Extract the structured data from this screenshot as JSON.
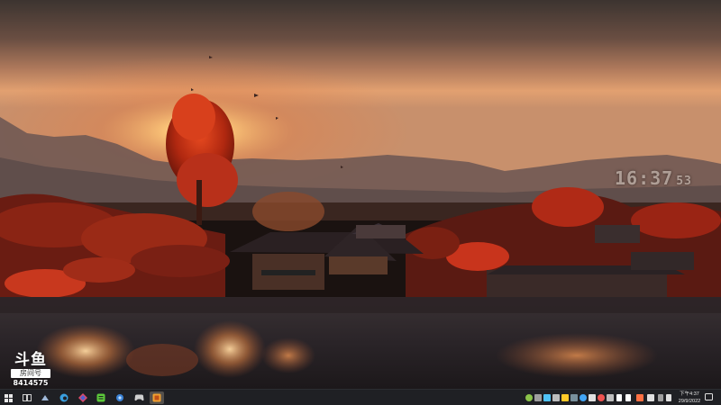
{
  "wallpaper": {
    "description_icon": "landscape-wallpaper"
  },
  "clock_widget": {
    "time": "16:37",
    "seconds": "53"
  },
  "watermark": {
    "logo": "斗鱼",
    "room_label": "房间号",
    "room_number": "8414575"
  },
  "taskbar": {
    "start_icon": "windows-start-icon",
    "pinned": [
      {
        "name": "task-view-icon",
        "color": "#cfcfcf"
      },
      {
        "name": "steam-icon",
        "color": "#9fb8d8"
      },
      {
        "name": "edge-icon",
        "color": "#3aa0e0"
      },
      {
        "name": "app-diamond-icon",
        "color": "#e04a6a"
      },
      {
        "name": "green-app-icon",
        "color": "#5cc83a"
      },
      {
        "name": "blue-circle-app-icon",
        "color": "#3b82d6"
      },
      {
        "name": "gamepad-icon",
        "color": "#cfcfcf"
      },
      {
        "name": "active-app-icon",
        "color": "#f0a030"
      }
    ],
    "tray_colors": [
      "#8bc34a",
      "#9e9e9e",
      "#4fc3f7",
      "#bdbdbd",
      "#ffca28",
      "#78909c",
      "#42a5f5",
      "#e0e0e0",
      "#ef5350",
      "#bdbdbd",
      "#ffffff",
      "#ffffff",
      "#ff7043",
      "#e0e0e0"
    ],
    "tray_clock": {
      "time": "下午4:37",
      "date": "29/9/2022"
    }
  }
}
